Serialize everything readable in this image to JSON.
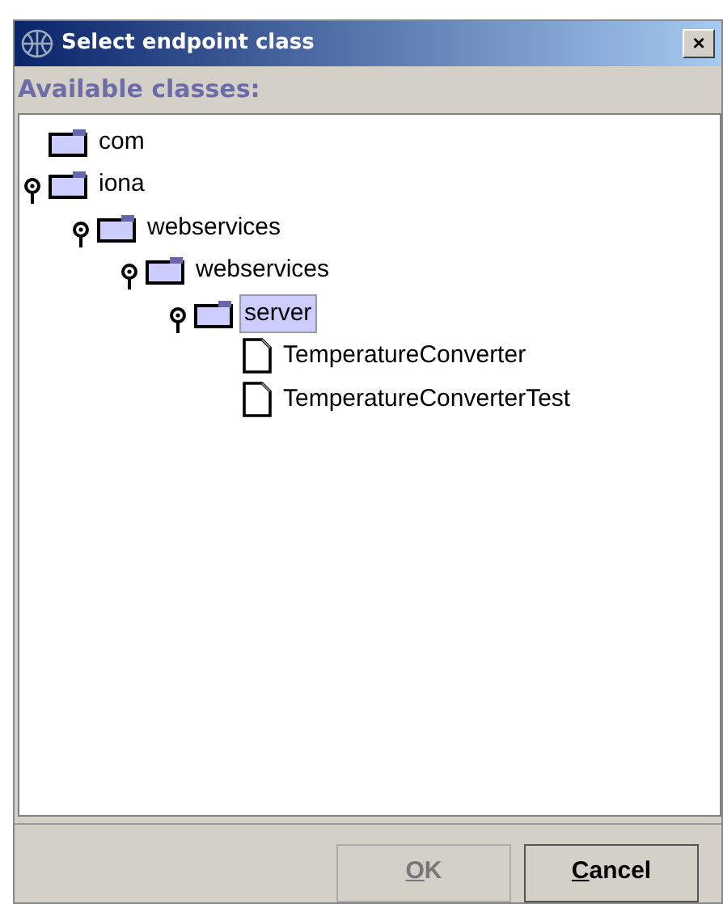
{
  "window": {
    "title": "Select endpoint class",
    "close_glyph": "×"
  },
  "label": "Available classes:",
  "tree": [
    {
      "kind": "folder",
      "label": "com",
      "expanded": false,
      "selected": false
    },
    {
      "kind": "folder",
      "label": "iona",
      "expanded": true,
      "selected": false,
      "children": [
        {
          "kind": "folder",
          "label": "webservices",
          "expanded": true,
          "selected": false,
          "children": [
            {
              "kind": "folder",
              "label": "webservices",
              "expanded": true,
              "selected": false,
              "children": [
                {
                  "kind": "folder",
                  "label": "server",
                  "expanded": true,
                  "selected": true,
                  "children": [
                    {
                      "kind": "file",
                      "label": "TemperatureConverter",
                      "selected": false
                    },
                    {
                      "kind": "file",
                      "label": "TemperatureConverterTest",
                      "selected": false
                    }
                  ]
                }
              ]
            }
          ]
        }
      ]
    }
  ],
  "buttons": [
    {
      "label": "OK",
      "disabled": true,
      "underline_first": true
    },
    {
      "label": "Cancel",
      "disabled": false,
      "underline_first": true
    }
  ]
}
